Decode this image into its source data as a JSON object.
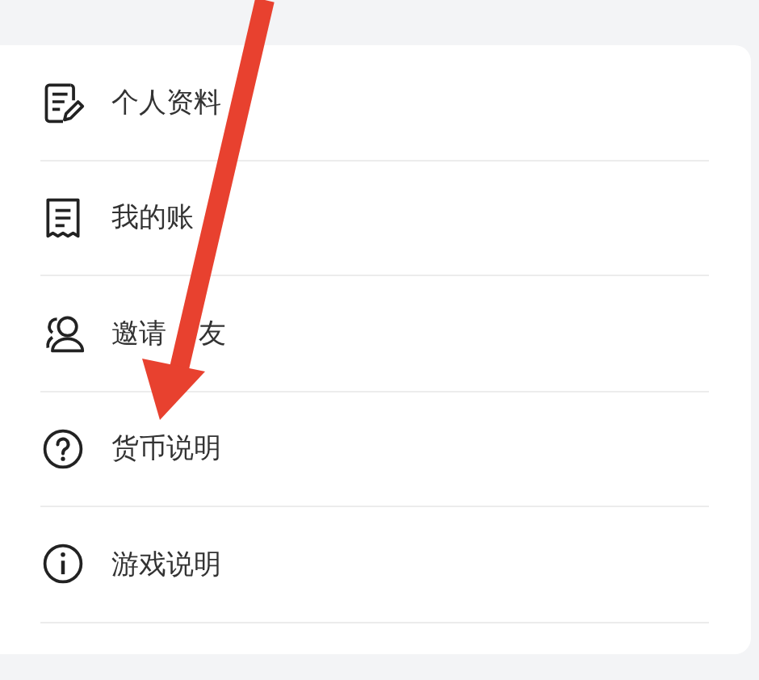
{
  "menu": {
    "items": [
      {
        "label": "个人资料"
      },
      {
        "label": "我的账"
      },
      {
        "label": "邀请",
        "label_2": "友"
      },
      {
        "label": "货币说明"
      },
      {
        "label": "游戏说明"
      }
    ]
  }
}
